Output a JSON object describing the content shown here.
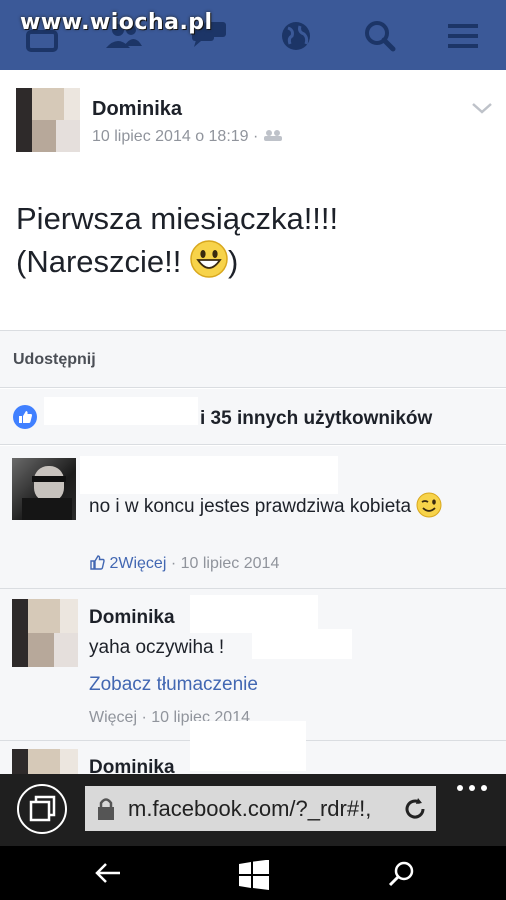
{
  "watermark": "www.wiocha.pl",
  "top_icons": [
    "home-icon",
    "friends-icon",
    "messages-icon",
    "globe-icon",
    "search-icon",
    "menu-icon"
  ],
  "post": {
    "author": "Dominika",
    "date": "10 lipiec 2014 o 18:19 ·",
    "text_line1": "Pierwsza miesiączka!!!!",
    "text_line2": "(Nareszcie!! ",
    "text_line2_end": ")"
  },
  "share": {
    "label": "Udostępnij"
  },
  "likes": {
    "text": "i 35 innych użytkowników"
  },
  "comments": [
    {
      "text": "no i w koncu jestes prawdziwa kobieta",
      "likes": "2",
      "more": "Więcej",
      "date": "· 10 lipiec 2014"
    },
    {
      "author": "Dominika",
      "text": "yaha oczywiha !",
      "translate": "Zobacz tłumaczenie",
      "more": "Więcej",
      "date": "· 10 lipiec 2014"
    },
    {
      "author": "Dominika"
    }
  ],
  "browser": {
    "url": "m.facebook.com/?_rdr#!,"
  },
  "colors": {
    "fb_blue": "#3b5998",
    "link_blue": "#4267b2",
    "like_blue": "#4080ff"
  }
}
